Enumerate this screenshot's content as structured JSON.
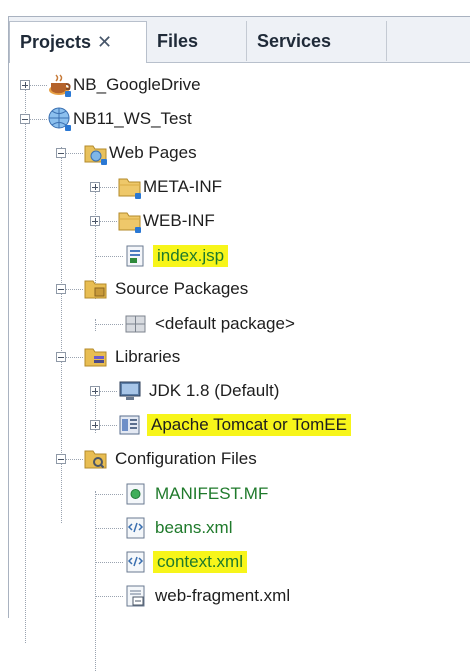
{
  "tabs": [
    {
      "label": "Projects",
      "close": "✕"
    },
    {
      "label": "Files"
    },
    {
      "label": "Services"
    }
  ],
  "tree": {
    "nb_googledrive": "NB_GoogleDrive",
    "nb11_ws_test": "NB11_WS_Test",
    "web_pages": "Web Pages",
    "meta_inf": "META-INF",
    "web_inf": "WEB-INF",
    "index_jsp": "index.jsp",
    "source_packages": "Source Packages",
    "default_package": "<default package>",
    "libraries": "Libraries",
    "jdk": "JDK 1.8 (Default)",
    "tomcat": "Apache Tomcat or TomEE",
    "config_files": "Configuration Files",
    "manifest": "MANIFEST.MF",
    "beans": "beans.xml",
    "context": "context.xml",
    "web_fragment": "web-fragment.xml"
  },
  "colors": {
    "highlight": "#f7f51a",
    "config_file_text": "#1f7a2b",
    "tab_bar": "#eef1f6"
  }
}
